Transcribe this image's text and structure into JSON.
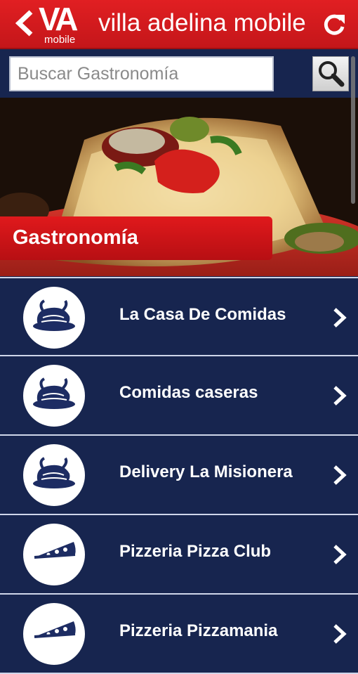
{
  "header": {
    "logo_big": "VA",
    "logo_small": "mobile",
    "title": "villa adelina mobile"
  },
  "search": {
    "placeholder": "Buscar Gastronomía",
    "icon": "search-icon"
  },
  "section": {
    "title": "Gastronomía"
  },
  "items": [
    {
      "label": "La Casa De Comidas",
      "icon": "roast-chicken-icon"
    },
    {
      "label": "Comidas caseras",
      "icon": "roast-chicken-icon"
    },
    {
      "label": "Delivery La Misionera",
      "icon": "roast-chicken-icon"
    },
    {
      "label": "Pizzeria Pizza Club",
      "icon": "pizza-slice-icon"
    },
    {
      "label": "Pizzeria Pizzamania",
      "icon": "pizza-slice-icon"
    }
  ],
  "colors": {
    "header_red": "#e11f22",
    "background_navy": "#17254f",
    "divider": "#cfd6ea"
  }
}
